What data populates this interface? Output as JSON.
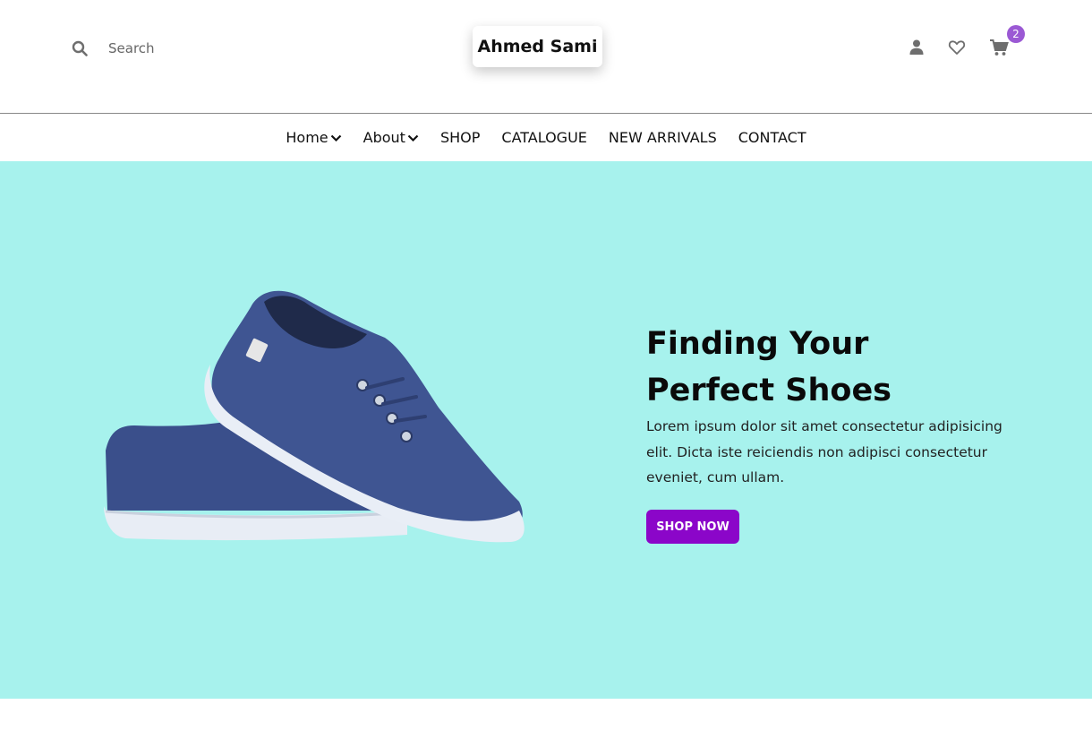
{
  "header": {
    "search": {
      "placeholder": "Search",
      "value": ""
    },
    "logo": "Ahmed Sami",
    "cart_count": "2",
    "icons": [
      "user-icon",
      "heart-icon",
      "cart-icon",
      "search-icon"
    ]
  },
  "nav": {
    "home": "Home",
    "about": "About",
    "shop": "SHOP",
    "catalogue": "CATALOGUE",
    "new_arrivals": "NEW ARRIVALS",
    "contact": "CONTACT"
  },
  "hero": {
    "title_line1": "Finding Your",
    "title_line2": "Perfect Shoes",
    "description_line1": "Lorem ipsum dolor sit amet consectetur adipisicing",
    "description_line2": "elit. Dicta iste reiciendis non adipisci consectetur",
    "description_line3": "eveniet, cum ullam.",
    "cta": "SHOP NOW"
  },
  "colors": {
    "hero_bg": "#a7f2ed",
    "accent": "#8b06c9",
    "badge": "#9b59d4",
    "icon": "#6e6e6e",
    "shoe": "#3f5592"
  }
}
